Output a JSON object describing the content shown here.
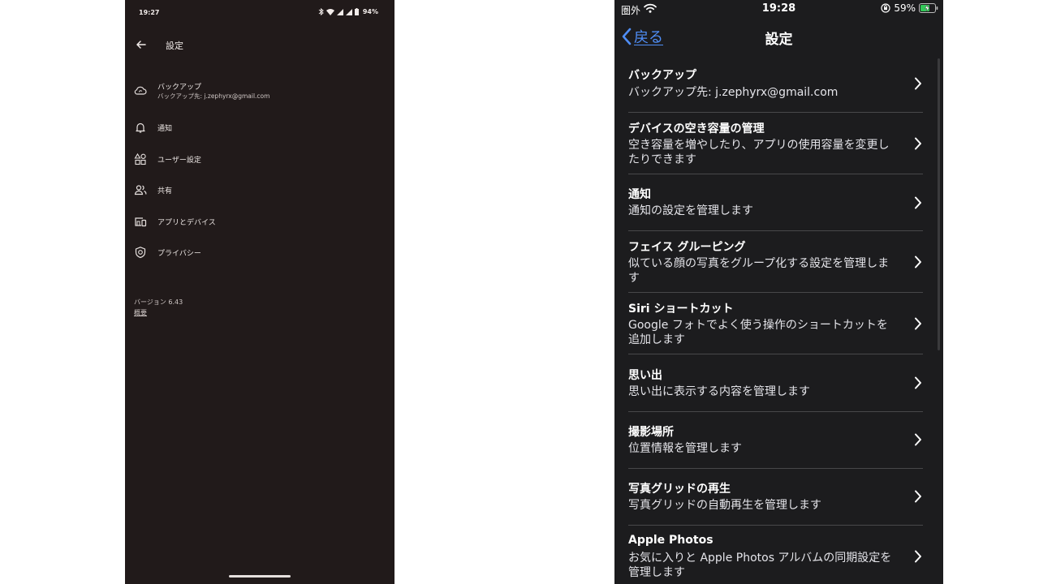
{
  "android": {
    "status": {
      "time": "19:27",
      "battery": "94%"
    },
    "title": "設定",
    "items": [
      {
        "label": "バックアップ",
        "sub": "バックアップ先: j.zephyrx@gmail.com",
        "icon": "cloud-sync-icon"
      },
      {
        "label": "通知",
        "icon": "bell-icon"
      },
      {
        "label": "ユーザー設定",
        "icon": "preferences-icon"
      },
      {
        "label": "共有",
        "icon": "people-icon"
      },
      {
        "label": "アプリとデバイス",
        "icon": "devices-icon"
      },
      {
        "label": "プライバシー",
        "icon": "shield-icon"
      }
    ],
    "version": "バージョン 6.43",
    "about": "概要"
  },
  "ios": {
    "status": {
      "carrier": "圏外",
      "time": "19:28",
      "battery": "59%"
    },
    "back_label": "戻る",
    "title": "設定",
    "rows": [
      {
        "title": "バックアップ",
        "desc": "バックアップ先: j.zephyrx@gmail.com"
      },
      {
        "title": "デバイスの空き容量の管理",
        "desc": "空き容量を増やしたり、アプリの使用容量を変更したりできます"
      },
      {
        "title": "通知",
        "desc": "通知の設定を管理します"
      },
      {
        "title": "フェイス グルーピング",
        "desc": "似ている顔の写真をグループ化する設定を管理します"
      },
      {
        "title": "Siri ショートカット",
        "desc": "Google フォトでよく使う操作のショートカットを追加します"
      },
      {
        "title": "思い出",
        "desc": "思い出に表示する内容を管理します"
      },
      {
        "title": "撮影場所",
        "desc": "位置情報を管理します"
      },
      {
        "title": "写真グリッドの再生",
        "desc": "写真グリッドの自動再生を管理します"
      },
      {
        "title": "Apple Photos",
        "desc": "お気に入りと Apple Photos アルバムの同期設定を管理します"
      }
    ]
  },
  "colors": {
    "android_bg": "#211a1a",
    "ios_bg": "#1c1c1e",
    "ios_accent": "#4f8ef7"
  }
}
